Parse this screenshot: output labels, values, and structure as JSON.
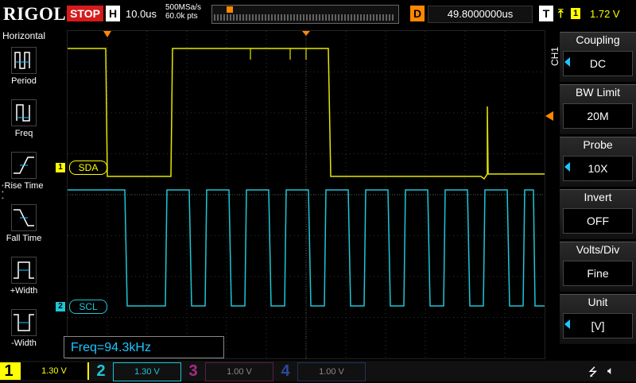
{
  "topbar": {
    "logo": "RIGOL",
    "run_state": "STOP",
    "h_badge": "H",
    "timebase": "10.0us",
    "sample_rate": "500MSa/s",
    "points": "60.0k pts",
    "d_badge": "D",
    "delay": "49.8000000us",
    "t_badge": "T",
    "trigger_edge_icon": "rising-edge-icon",
    "trigger_channel": "1",
    "trigger_level": "1.72 V"
  },
  "left_panel": {
    "title": "Horizontal",
    "items": [
      {
        "label": "Period",
        "icon": "period-icon"
      },
      {
        "label": "Freq",
        "icon": "freq-icon"
      },
      {
        "label": "Rise Time",
        "icon": "rise-time-icon"
      },
      {
        "label": "Fall Time",
        "icon": "fall-time-icon"
      },
      {
        "label": "+Width",
        "icon": "plus-width-icon"
      },
      {
        "label": "-Width",
        "icon": "minus-width-icon"
      }
    ]
  },
  "channels_on_screen": {
    "ch1": {
      "marker": "1",
      "label": "SDA",
      "color": "#e6e600"
    },
    "ch2": {
      "marker": "2",
      "label": "SCL",
      "color": "#1ec6d6"
    }
  },
  "right_panel": {
    "channel_tag": "CH1",
    "items": [
      {
        "title": "Coupling",
        "value": "DC",
        "has_arrow": true
      },
      {
        "title": "BW Limit",
        "value": "20M",
        "has_arrow": false
      },
      {
        "title": "Probe",
        "value": "10X",
        "has_arrow": true
      },
      {
        "title": "Invert",
        "value": "OFF",
        "has_arrow": false
      },
      {
        "title": "Volts/Div",
        "value": "Fine",
        "has_arrow": false
      },
      {
        "title": "Unit",
        "value": "[V]",
        "has_arrow": true
      }
    ]
  },
  "measurement": {
    "text": "Freq=94.3kHz"
  },
  "bottombar": {
    "channels": [
      {
        "num": "1",
        "scale": "1.30 V",
        "color": "#ffff00",
        "active": true
      },
      {
        "num": "2",
        "scale": "1.30 V",
        "color": "#1ec6d6",
        "active": true
      },
      {
        "num": "3",
        "scale": "1.00 V",
        "color": "#aa2a88",
        "active": false
      },
      {
        "num": "4",
        "scale": "1.00 V",
        "color": "#2a4a9a",
        "active": false
      }
    ]
  }
}
